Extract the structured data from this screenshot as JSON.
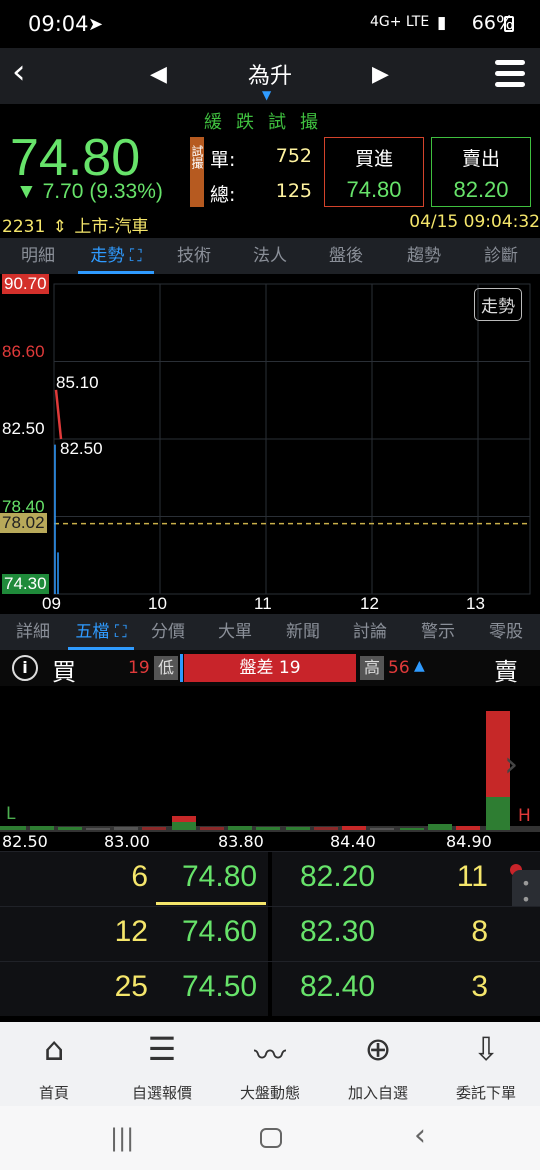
{
  "status_bar": {
    "time": "09:04",
    "battery": "66%",
    "net": "4G+ LTE"
  },
  "nav": {
    "title": "為升"
  },
  "quote": {
    "price": "74.80",
    "change": "▼ 7.70 (9.33%)",
    "status_text": "緩跌試撮",
    "trial_tag": "試撮",
    "single_label": "單:",
    "single_value": "752",
    "total_label": "總:",
    "total_value": "125",
    "buy_label": "買進",
    "buy_price": "74.80",
    "sell_label": "賣出",
    "sell_price": "82.20",
    "code": "2231",
    "market": "上市-汽車",
    "datetime": "04/15 09:04:32"
  },
  "tabs_top": [
    {
      "label": "明細"
    },
    {
      "label": "走勢"
    },
    {
      "label": "技術"
    },
    {
      "label": "法人"
    },
    {
      "label": "盤後"
    },
    {
      "label": "趨勢"
    },
    {
      "label": "診斷"
    }
  ],
  "chart_data": {
    "type": "line",
    "title": "",
    "badge": "走勢",
    "y_ticks": [
      "90.70",
      "86.60",
      "82.50",
      "78.40",
      "74.30"
    ],
    "ref_price": "78.02",
    "x_ticks": [
      "09",
      "10",
      "11",
      "12",
      "13"
    ],
    "ylim": [
      74.3,
      90.7
    ],
    "series": [
      {
        "values": [
          85.1,
          82.5
        ]
      }
    ],
    "annotations": [
      "85.10",
      "82.50"
    ]
  },
  "tabs_bottom": [
    {
      "label": "詳細"
    },
    {
      "label": "五檔"
    },
    {
      "label": "分價"
    },
    {
      "label": "大單"
    },
    {
      "label": "新聞"
    },
    {
      "label": "討論"
    },
    {
      "label": "警示"
    },
    {
      "label": "零股"
    }
  ],
  "orderbook_header": {
    "buy": "買",
    "sell": "賣",
    "low_value": "19",
    "low_label": "低",
    "diff_text": "盤差 19",
    "high_label": "高",
    "high_value": "56"
  },
  "histogram": {
    "x_ticks": [
      "82.50",
      "83.00",
      "83.80",
      "84.40",
      "84.90"
    ],
    "low_marker": "L",
    "high_marker": "H"
  },
  "orders": [
    {
      "bid_qty": "6",
      "bid": "74.80",
      "ask": "82.20",
      "ask_qty": "11"
    },
    {
      "bid_qty": "12",
      "bid": "74.60",
      "ask": "82.30",
      "ask_qty": "8"
    },
    {
      "bid_qty": "25",
      "bid": "74.50",
      "ask": "82.40",
      "ask_qty": "3"
    }
  ],
  "bottom_nav": [
    {
      "label": "首頁"
    },
    {
      "label": "自選報價"
    },
    {
      "label": "大盤動態"
    },
    {
      "label": "加入自選"
    },
    {
      "label": "委託下單"
    }
  ],
  "colors": {
    "up": "#e03a3a",
    "down": "#67e36a",
    "accent": "#2f9bff",
    "yellow": "#f5e66b"
  }
}
